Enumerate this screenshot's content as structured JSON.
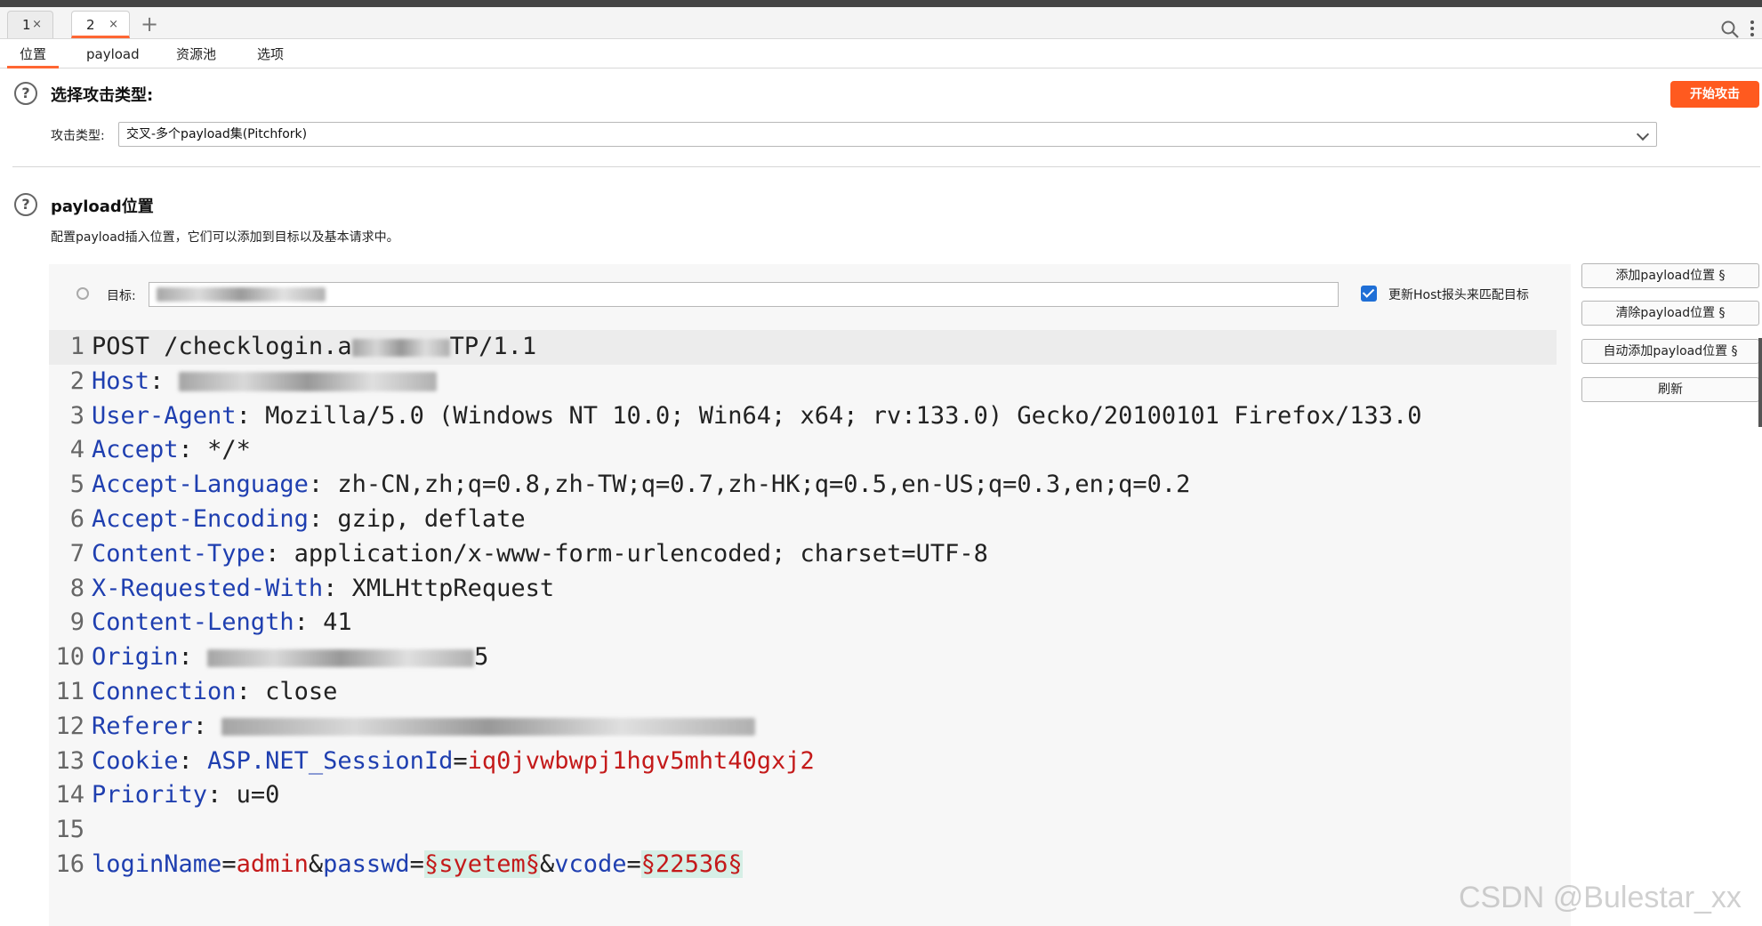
{
  "request_tabs": [
    {
      "label": "1",
      "close": "×",
      "active": false
    },
    {
      "label": "2",
      "close": "×",
      "active": true
    }
  ],
  "new_tab": "+",
  "sub_tabs": [
    "位置",
    "payload",
    "资源池",
    "选项"
  ],
  "attack_section": {
    "help": "?",
    "title": "选择攻击类型:",
    "start_button": "开始攻击",
    "type_label": "攻击类型:",
    "type_value": "交叉-多个payload集(Pitchfork)"
  },
  "positions_section": {
    "help": "?",
    "title": "payload位置",
    "description": "配置payload插入位置，它们可以添加到目标以及基本请求中。",
    "target_label": "目标:",
    "update_host_label": "更新Host报头来匹配目标",
    "buttons": [
      "添加payload位置 §",
      "清除payload位置 §",
      "自动添加payload位置 §",
      "刷新"
    ]
  },
  "request": {
    "lines": [
      {
        "n": "1",
        "method": "POST",
        "path": " /checklogin.a",
        "rest": "TP/1.1"
      },
      {
        "n": "2",
        "key": "Host",
        "sep": ": "
      },
      {
        "n": "3",
        "key": "User-Agent",
        "sep": ": ",
        "val": "Mozilla/5.0 (Windows NT 10.0; Win64; x64; rv:133.0) Gecko/20100101 Firefox/133.0"
      },
      {
        "n": "4",
        "key": "Accept",
        "sep": ": ",
        "val": "*/*"
      },
      {
        "n": "5",
        "key": "Accept-Language",
        "sep": ": ",
        "val": "zh-CN,zh;q=0.8,zh-TW;q=0.7,zh-HK;q=0.5,en-US;q=0.3,en;q=0.2"
      },
      {
        "n": "6",
        "key": "Accept-Encoding",
        "sep": ": ",
        "val": "gzip, deflate"
      },
      {
        "n": "7",
        "key": "Content-Type",
        "sep": ": ",
        "val": "application/x-www-form-urlencoded; charset=UTF-8"
      },
      {
        "n": "8",
        "key": "X-Requested-With",
        "sep": ": ",
        "val": "XMLHttpRequest"
      },
      {
        "n": "9",
        "key": "Content-Length",
        "sep": ": ",
        "val": "41"
      },
      {
        "n": "10",
        "key": "Origin",
        "sep": ": ",
        "val": "5"
      },
      {
        "n": "11",
        "key": "Connection",
        "sep": ": ",
        "val": "close"
      },
      {
        "n": "12",
        "key": "Referer",
        "sep": ": "
      },
      {
        "n": "13",
        "key": "Cookie",
        "sep": ": ",
        "ckey": "ASP.NET_SessionId",
        "eq": "=",
        "cval": "iq0jvwbwpj1hgv5mht40gxj2"
      },
      {
        "n": "14",
        "key": "Priority",
        "sep": ": ",
        "val": "u=0"
      },
      {
        "n": "15"
      },
      {
        "n": "16",
        "p1k": "loginName",
        "p1e": "=",
        "p1v": "admin",
        "amp1": "&",
        "p2k": "passwd",
        "p2e": "=",
        "p2v": "§syetem§",
        "amp2": "&",
        "p3k": "vcode",
        "p3e": "=",
        "p3v": "§22536§"
      }
    ]
  },
  "watermark": "CSDN @Bulestar_xx",
  "colors": {
    "accent": "#ff5a1f",
    "header_key": "#1f3fb0",
    "param_value": "#c41a1a",
    "payload_bg": "#d6efe6",
    "checkbox": "#1f6fd6"
  }
}
